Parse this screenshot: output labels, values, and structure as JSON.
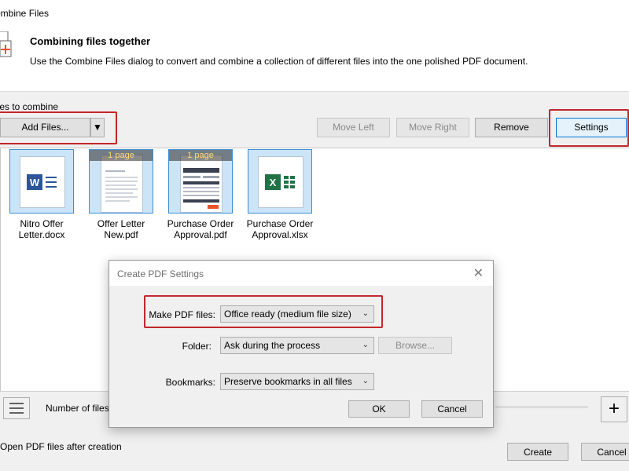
{
  "window": {
    "title": "ombine Files"
  },
  "header": {
    "icon": "combine-files-icon",
    "title": "Combining files together",
    "description": "Use the Combine Files dialog to convert and combine a collection of different files into the one polished PDF document."
  },
  "files_section": {
    "label": "iles to combine"
  },
  "toolbar": {
    "add_files": "Add Files...",
    "move_left": "Move Left",
    "move_right": "Move Right",
    "remove": "Remove",
    "settings": "Settings"
  },
  "files": [
    {
      "name_line1": "Nitro Offer",
      "name_line2": "Letter.docx",
      "type": "word",
      "page_badge": ""
    },
    {
      "name_line1": "Offer Letter",
      "name_line2": "New.pdf",
      "type": "pdf-letter",
      "page_badge": "1 page"
    },
    {
      "name_line1": "Purchase Order",
      "name_line2": "Approval.pdf",
      "type": "pdf-form",
      "page_badge": "1 page"
    },
    {
      "name_line1": "Purchase Order",
      "name_line2": "Approval.xlsx",
      "type": "excel",
      "page_badge": ""
    }
  ],
  "bottom": {
    "number_of_files_label": "Number of files:",
    "open_after_label": "Open PDF files after creation",
    "create": "Create",
    "cancel": "Cancel"
  },
  "dialog": {
    "title": "Create PDF Settings",
    "make_pdf_label": "Make PDF files:",
    "make_pdf_value": "Office ready (medium file size)",
    "folder_label": "Folder:",
    "folder_value": "Ask during the process",
    "browse": "Browse...",
    "bookmarks_label": "Bookmarks:",
    "bookmarks_value": "Preserve bookmarks in all files",
    "ok": "OK",
    "cancel": "Cancel"
  },
  "colors": {
    "highlight_red": "#c0272d",
    "selection_blue": "#cce4f7",
    "word_blue": "#2b579a",
    "excel_green": "#217346",
    "accent_orange": "#e8542a"
  }
}
